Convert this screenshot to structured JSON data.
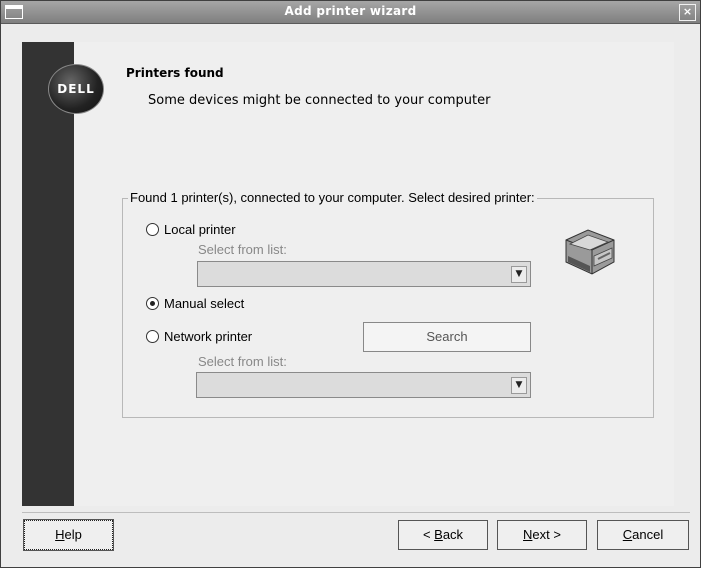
{
  "window": {
    "title": "Add printer wizard",
    "close_glyph": "×"
  },
  "logo": {
    "text": "DELL"
  },
  "header": {
    "title": "Printers found",
    "subtitle": "Some devices might be connected to your computer"
  },
  "group": {
    "legend": "Found 1 printer(s), connected to your computer. Select desired printer:"
  },
  "options": {
    "local": {
      "label": "Local printer",
      "checked": false,
      "sub_label": "Select from list:",
      "combo_value": ""
    },
    "manual": {
      "label": "Manual select",
      "checked": true
    },
    "network": {
      "label": "Network printer",
      "checked": false,
      "sub_label": "Select from list:",
      "combo_value": ""
    }
  },
  "search_button": {
    "label": "Search"
  },
  "footer": {
    "help": {
      "label": "Help",
      "accel": "H",
      "rest": "elp"
    },
    "back": {
      "prefix": "< ",
      "accel": "B",
      "rest": "ack"
    },
    "next": {
      "accel": "N",
      "rest": "ext >"
    },
    "cancel": {
      "accel": "C",
      "rest": "ancel"
    }
  },
  "icons": {
    "printer": "printer-icon",
    "combo_arrow": "chevron-down-icon"
  }
}
